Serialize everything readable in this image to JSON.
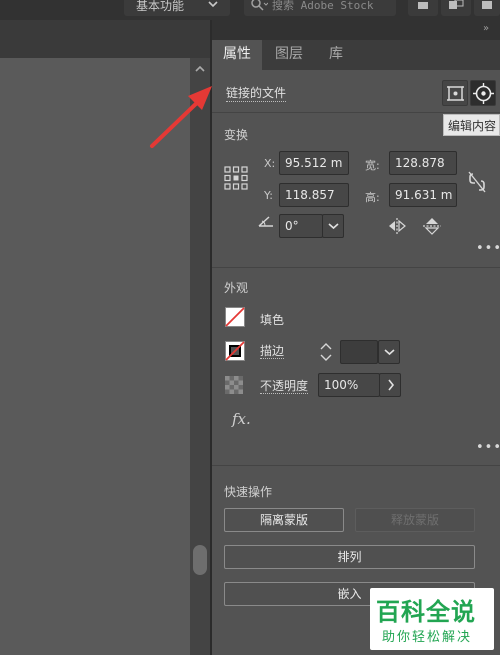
{
  "topbar": {
    "workspace_label": "基本功能",
    "stock_placeholder": "搜索 Adobe Stock"
  },
  "panel": {
    "tabs": [
      {
        "label": "属性",
        "active": true
      },
      {
        "label": "图层",
        "active": false
      },
      {
        "label": "库",
        "active": false
      }
    ],
    "linked_file_label": "链接的文件",
    "tooltip": "编辑内容",
    "transform": {
      "title": "变换",
      "x_label": "X:",
      "x_value": "95.512 m",
      "y_label": "Y:",
      "y_value": "118.857",
      "width_label": "宽:",
      "width_value": "128.878",
      "height_label": "高:",
      "height_value": "91.631 m",
      "angle_value": "0°"
    },
    "appearance": {
      "title": "外观",
      "fill_label": "填色",
      "stroke_label": "描边",
      "opacity_label": "不透明度",
      "opacity_value": "100%",
      "fx_label": "fx."
    },
    "quick_actions": {
      "title": "快速操作",
      "isolate_mask_label": "隔离蒙版",
      "release_mask_label": "释放蒙版",
      "arrange_label": "排列",
      "embed_label": "嵌入"
    }
  },
  "watermark": {
    "title": "百科全说",
    "subtitle": "助你轻松解决"
  },
  "colors": {
    "annotation_arrow": "#e53935",
    "panel_bg": "#535353",
    "watermark_green": "#22a552"
  }
}
